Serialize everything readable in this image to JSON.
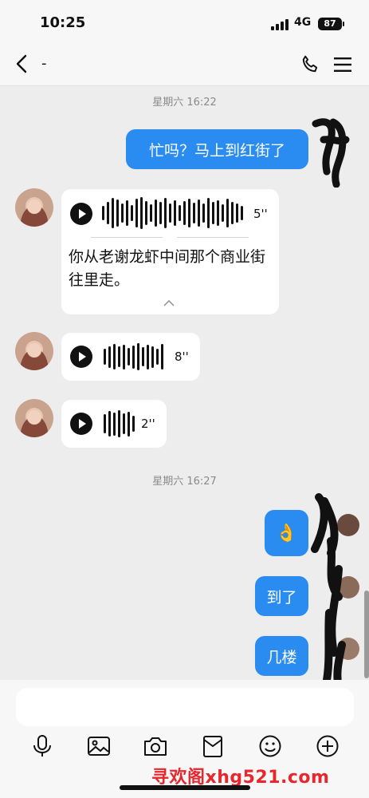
{
  "status_bar": {
    "time": "10:25",
    "network": "4G",
    "battery": "87"
  },
  "header": {
    "contact_name": "-"
  },
  "timestamps": [
    "星期六 16:22",
    "星期六 16:27"
  ],
  "messages": {
    "out_1": "忙吗？马上到红街了",
    "voice_1": {
      "duration": "5''",
      "transcript": "你从老谢龙虾中间那个商业街往里走。"
    },
    "voice_2": {
      "duration": "8''"
    },
    "voice_3": {
      "duration": "2''"
    },
    "out_2": "👌",
    "out_3": "到了",
    "out_4": "几楼"
  },
  "toolbar_icons": [
    "microphone-icon",
    "image-icon",
    "camera-icon",
    "red-packet-icon",
    "emoji-icon",
    "plus-icon"
  ],
  "watermark": "寻欢阁xhg521.com",
  "colors": {
    "accent": "#2a8cf0",
    "watermark": "#e8262d"
  }
}
